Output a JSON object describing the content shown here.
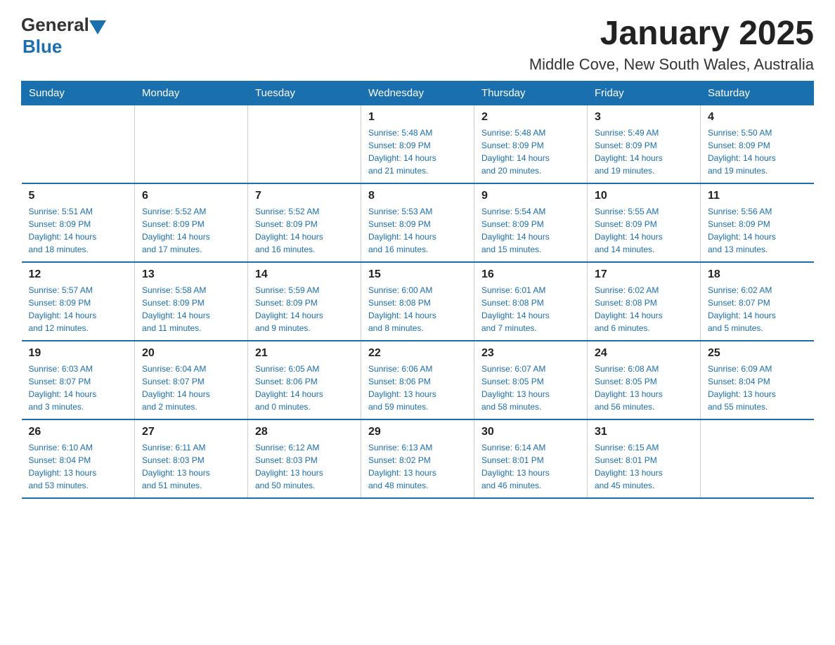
{
  "header": {
    "logo_general": "General",
    "logo_blue": "Blue",
    "title": "January 2025",
    "subtitle": "Middle Cove, New South Wales, Australia"
  },
  "weekdays": [
    "Sunday",
    "Monday",
    "Tuesday",
    "Wednesday",
    "Thursday",
    "Friday",
    "Saturday"
  ],
  "weeks": [
    [
      {
        "day": "",
        "info": ""
      },
      {
        "day": "",
        "info": ""
      },
      {
        "day": "",
        "info": ""
      },
      {
        "day": "1",
        "info": "Sunrise: 5:48 AM\nSunset: 8:09 PM\nDaylight: 14 hours\nand 21 minutes."
      },
      {
        "day": "2",
        "info": "Sunrise: 5:48 AM\nSunset: 8:09 PM\nDaylight: 14 hours\nand 20 minutes."
      },
      {
        "day": "3",
        "info": "Sunrise: 5:49 AM\nSunset: 8:09 PM\nDaylight: 14 hours\nand 19 minutes."
      },
      {
        "day": "4",
        "info": "Sunrise: 5:50 AM\nSunset: 8:09 PM\nDaylight: 14 hours\nand 19 minutes."
      }
    ],
    [
      {
        "day": "5",
        "info": "Sunrise: 5:51 AM\nSunset: 8:09 PM\nDaylight: 14 hours\nand 18 minutes."
      },
      {
        "day": "6",
        "info": "Sunrise: 5:52 AM\nSunset: 8:09 PM\nDaylight: 14 hours\nand 17 minutes."
      },
      {
        "day": "7",
        "info": "Sunrise: 5:52 AM\nSunset: 8:09 PM\nDaylight: 14 hours\nand 16 minutes."
      },
      {
        "day": "8",
        "info": "Sunrise: 5:53 AM\nSunset: 8:09 PM\nDaylight: 14 hours\nand 16 minutes."
      },
      {
        "day": "9",
        "info": "Sunrise: 5:54 AM\nSunset: 8:09 PM\nDaylight: 14 hours\nand 15 minutes."
      },
      {
        "day": "10",
        "info": "Sunrise: 5:55 AM\nSunset: 8:09 PM\nDaylight: 14 hours\nand 14 minutes."
      },
      {
        "day": "11",
        "info": "Sunrise: 5:56 AM\nSunset: 8:09 PM\nDaylight: 14 hours\nand 13 minutes."
      }
    ],
    [
      {
        "day": "12",
        "info": "Sunrise: 5:57 AM\nSunset: 8:09 PM\nDaylight: 14 hours\nand 12 minutes."
      },
      {
        "day": "13",
        "info": "Sunrise: 5:58 AM\nSunset: 8:09 PM\nDaylight: 14 hours\nand 11 minutes."
      },
      {
        "day": "14",
        "info": "Sunrise: 5:59 AM\nSunset: 8:09 PM\nDaylight: 14 hours\nand 9 minutes."
      },
      {
        "day": "15",
        "info": "Sunrise: 6:00 AM\nSunset: 8:08 PM\nDaylight: 14 hours\nand 8 minutes."
      },
      {
        "day": "16",
        "info": "Sunrise: 6:01 AM\nSunset: 8:08 PM\nDaylight: 14 hours\nand 7 minutes."
      },
      {
        "day": "17",
        "info": "Sunrise: 6:02 AM\nSunset: 8:08 PM\nDaylight: 14 hours\nand 6 minutes."
      },
      {
        "day": "18",
        "info": "Sunrise: 6:02 AM\nSunset: 8:07 PM\nDaylight: 14 hours\nand 5 minutes."
      }
    ],
    [
      {
        "day": "19",
        "info": "Sunrise: 6:03 AM\nSunset: 8:07 PM\nDaylight: 14 hours\nand 3 minutes."
      },
      {
        "day": "20",
        "info": "Sunrise: 6:04 AM\nSunset: 8:07 PM\nDaylight: 14 hours\nand 2 minutes."
      },
      {
        "day": "21",
        "info": "Sunrise: 6:05 AM\nSunset: 8:06 PM\nDaylight: 14 hours\nand 0 minutes."
      },
      {
        "day": "22",
        "info": "Sunrise: 6:06 AM\nSunset: 8:06 PM\nDaylight: 13 hours\nand 59 minutes."
      },
      {
        "day": "23",
        "info": "Sunrise: 6:07 AM\nSunset: 8:05 PM\nDaylight: 13 hours\nand 58 minutes."
      },
      {
        "day": "24",
        "info": "Sunrise: 6:08 AM\nSunset: 8:05 PM\nDaylight: 13 hours\nand 56 minutes."
      },
      {
        "day": "25",
        "info": "Sunrise: 6:09 AM\nSunset: 8:04 PM\nDaylight: 13 hours\nand 55 minutes."
      }
    ],
    [
      {
        "day": "26",
        "info": "Sunrise: 6:10 AM\nSunset: 8:04 PM\nDaylight: 13 hours\nand 53 minutes."
      },
      {
        "day": "27",
        "info": "Sunrise: 6:11 AM\nSunset: 8:03 PM\nDaylight: 13 hours\nand 51 minutes."
      },
      {
        "day": "28",
        "info": "Sunrise: 6:12 AM\nSunset: 8:03 PM\nDaylight: 13 hours\nand 50 minutes."
      },
      {
        "day": "29",
        "info": "Sunrise: 6:13 AM\nSunset: 8:02 PM\nDaylight: 13 hours\nand 48 minutes."
      },
      {
        "day": "30",
        "info": "Sunrise: 6:14 AM\nSunset: 8:01 PM\nDaylight: 13 hours\nand 46 minutes."
      },
      {
        "day": "31",
        "info": "Sunrise: 6:15 AM\nSunset: 8:01 PM\nDaylight: 13 hours\nand 45 minutes."
      },
      {
        "day": "",
        "info": ""
      }
    ]
  ]
}
